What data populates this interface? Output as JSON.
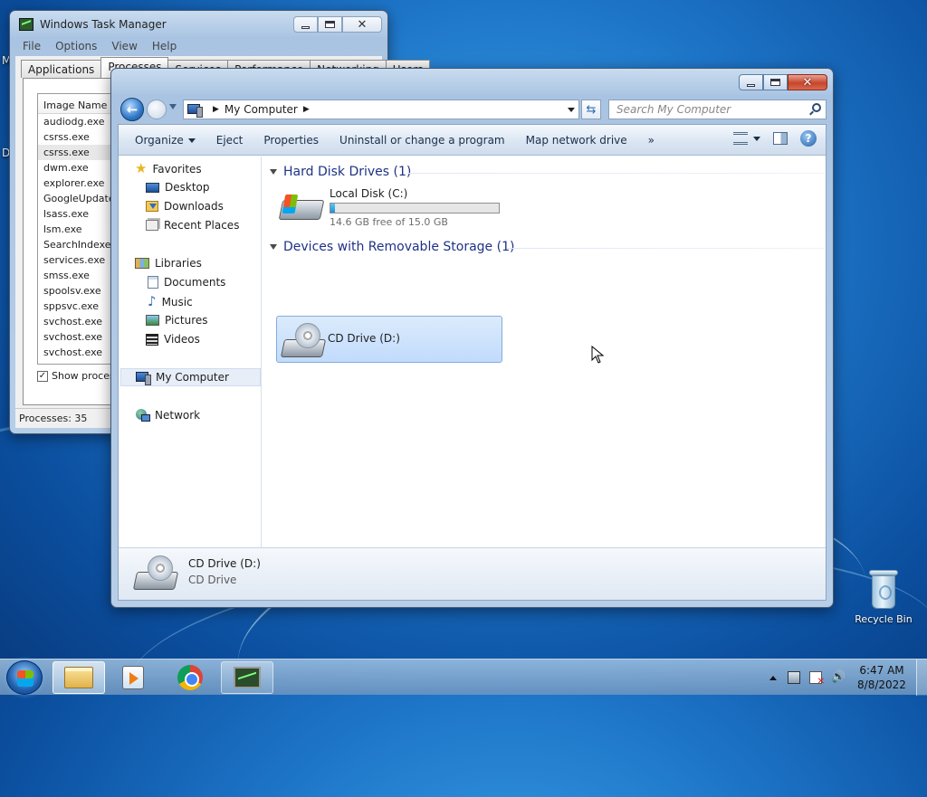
{
  "desktop": {
    "recycle_bin_label": "Recycle Bin",
    "edge_letters": [
      "M",
      "D"
    ]
  },
  "task_manager": {
    "title": "Windows Task Manager",
    "menu": [
      "File",
      "Options",
      "View",
      "Help"
    ],
    "tabs": [
      "Applications",
      "Processes",
      "Services",
      "Performance",
      "Networking",
      "Users"
    ],
    "active_tab": "Processes",
    "column_header": "Image Name",
    "processes": [
      "audiodg.exe",
      "csrss.exe",
      "csrss.exe",
      "dwm.exe",
      "explorer.exe",
      "GoogleUpdate.",
      "lsass.exe",
      "lsm.exe",
      "SearchIndexe.",
      "services.exe",
      "smss.exe",
      "spoolsv.exe",
      "sppsvc.exe",
      "svchost.exe",
      "svchost.exe",
      "svchost.exe"
    ],
    "selected_index": 2,
    "show_processes_label": "Show process",
    "status": "Processes: 35"
  },
  "explorer": {
    "address": "My Computer",
    "search_placeholder": "Search My Computer",
    "commands": [
      "Organize",
      "Eject",
      "Properties",
      "Uninstall or change a program",
      "Map network drive"
    ],
    "more_label": "»",
    "nav": {
      "favorites": "Favorites",
      "desktop": "Desktop",
      "downloads": "Downloads",
      "recent": "Recent Places",
      "libraries": "Libraries",
      "documents": "Documents",
      "music": "Music",
      "pictures": "Pictures",
      "videos": "Videos",
      "computer": "My Computer",
      "network": "Network"
    },
    "groups": {
      "hdd": "Hard Disk Drives (1)",
      "removable": "Devices with Removable Storage (1)"
    },
    "local_disk": {
      "name": "Local Disk (C:)",
      "free_text": "14.6 GB free of 15.0 GB",
      "used_fraction": 0.027
    },
    "cd_drive": {
      "name": "CD Drive (D:)"
    },
    "details": {
      "name": "CD Drive (D:)",
      "type": "CD Drive"
    }
  },
  "taskbar": {
    "time": "6:47 AM",
    "date": "8/8/2022"
  }
}
